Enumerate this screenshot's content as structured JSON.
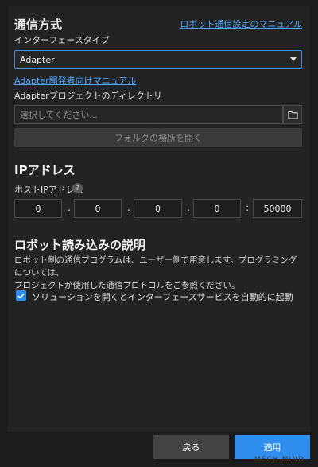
{
  "comm": {
    "title": "通信方式",
    "manual_link": "ロボット通信設定のマニュアル",
    "interface_label": "インターフェースタイプ",
    "interface_value": "Adapter",
    "dev_manual_link": "Adapter開発者向けマニュアル",
    "dir_label": "Adapterプロジェクトのディレクトリ",
    "dir_placeholder": "選択してください...",
    "open_folder_label": "フォルダの場所を開く"
  },
  "ip": {
    "title": "IPアドレス",
    "host_label": "ホストIPアドレス",
    "help_glyph": "?",
    "octets": [
      "0",
      "0",
      "0",
      "0"
    ],
    "port": "50000",
    "dot": ".",
    "colon": ":"
  },
  "robot": {
    "title": "ロボット読み込みの説明",
    "desc_line1": "ロボット側の通信プログラムは、ユーザー側で用意します。プログラミングについては、",
    "desc_line2": "プロジェクトが使用した通信プロトコルをご参照ください。",
    "checkbox_label": "ソリューションを開くとインターフェースサービスを自動的に起動",
    "checkbox_checked": true
  },
  "footer": {
    "back_label": "戻る",
    "apply_label": "適用",
    "watermark": "MECH-MIND"
  },
  "colors": {
    "accent": "#2f8ded",
    "link": "#4ea7ff",
    "panel": "#232323"
  }
}
